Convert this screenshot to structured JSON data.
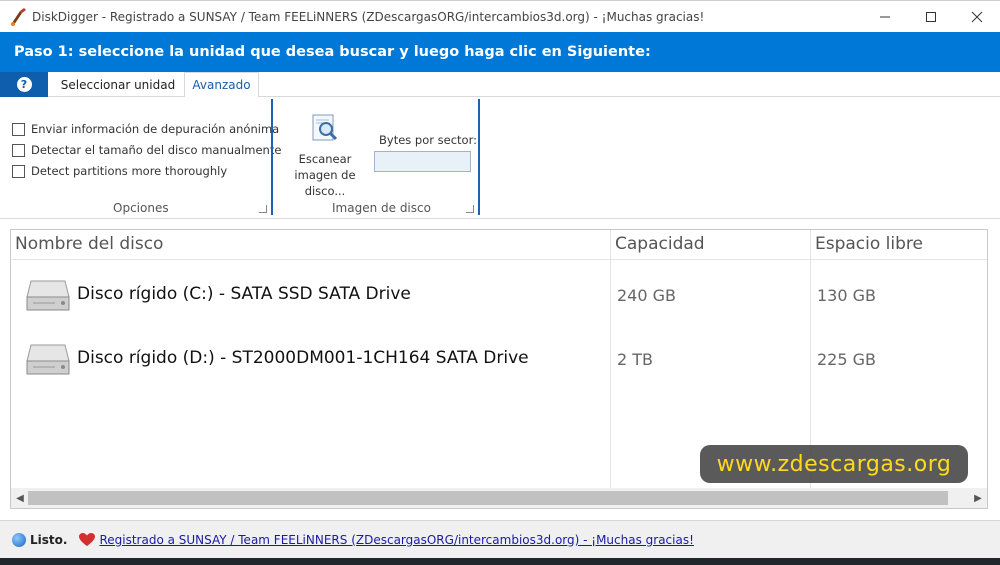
{
  "window": {
    "title": "DiskDigger - Registrado a SUNSAY / Team FEELiNNERS (ZDescargasORG/intercambios3d.org) - ¡Muchas gracias!",
    "controls": [
      "minimize",
      "maximize",
      "close"
    ]
  },
  "step": {
    "heading": "Paso 1: seleccione la unidad que desea buscar y luego haga clic en Siguiente:"
  },
  "tabs": {
    "help_glyph": "?",
    "select_unit": "Seleccionar unidad",
    "advanced": "Avanzado",
    "active": "Avanzado"
  },
  "options": {
    "checks": [
      {
        "label": "Enviar información de depuración anónima",
        "checked": false
      },
      {
        "label": "Detectar el tamaño del disco manualmente",
        "checked": false
      },
      {
        "label": "Detect partitions more thoroughly",
        "checked": false
      }
    ],
    "group_label": "Opciones"
  },
  "disk_image": {
    "scan_line1": "Escanear",
    "scan_line2": "imagen de",
    "scan_line3": "disco...",
    "bytes_label": "Bytes por sector:",
    "bytes_value": "",
    "group_label": "Imagen de disco"
  },
  "disk_list": {
    "columns": [
      "Nombre del disco",
      "Capacidad",
      "Espacio libre"
    ],
    "rows": [
      {
        "name": "Disco rígido (C:) - SATA SSD SATA Drive",
        "capacity": "240 GB",
        "free": "130 GB",
        "icon": "hard-drive-icon"
      },
      {
        "name": "Disco rígido (D:) - ST2000DM001-1CH164 SATA Drive",
        "capacity": "2 TB",
        "free": "225 GB",
        "icon": "hard-drive-icon"
      }
    ]
  },
  "watermark": "www.zdescargas.org",
  "status": {
    "text": "Listo.",
    "link": "Registrado a SUNSAY / Team FEELiNNERS (ZDescargasORG/intercambios3d.org) - ¡Muchas gracias!"
  },
  "colors": {
    "accent": "#0078d7",
    "help_tab": "#0f5dad",
    "watermark_text": "#ffd700"
  }
}
